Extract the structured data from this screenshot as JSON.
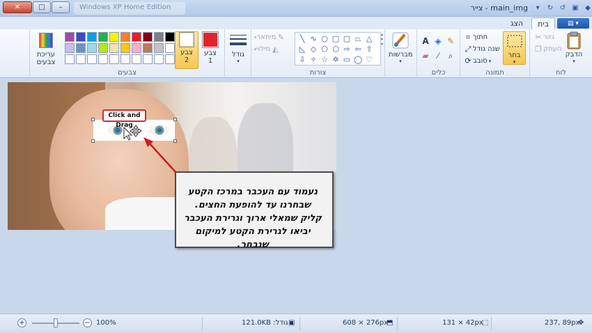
{
  "window": {
    "title": "צייר - main_img",
    "background_tab": "Windows XP Home Edition",
    "controls": {
      "close": "✕",
      "maximize": "□",
      "minimize": "–"
    }
  },
  "ribbon_tabs": {
    "home": "בית",
    "view": "הצג",
    "file_icon": "menu-icon"
  },
  "groups": {
    "clipboard": {
      "label": "לוח",
      "paste": "הדבק",
      "cut": "גזור",
      "copy": "העתק"
    },
    "image": {
      "label": "תמונה",
      "select": "בחר",
      "crop": "חתוך",
      "resize": "שנה גודל",
      "rotate": "סובב"
    },
    "tools": {
      "label": "כלים"
    },
    "brushes": {
      "label": "מברשות"
    },
    "shapes": {
      "label": "צורות",
      "outline": "מיתאר",
      "fill": "מילוי"
    },
    "size": {
      "label": "גודל"
    },
    "colors": {
      "label": "צבעים",
      "color1": "צבע 1",
      "color1_line1": "צבע",
      "color1_line2": "1",
      "color2_line1": "צבע",
      "color2_line2": "2",
      "edit_colors_line1": "עריכת",
      "edit_colors_line2": "צבעים",
      "color1_value": "#e5222b",
      "color2_value": "#ffffff",
      "palette_row1": [
        "#000000",
        "#7f7f7f",
        "#880015",
        "#ed1c24",
        "#ff7f27",
        "#fff200",
        "#22b14c",
        "#00a2e8",
        "#3f48cc",
        "#a349a4"
      ],
      "palette_row2": [
        "#ffffff",
        "#c3c3c3",
        "#b97a57",
        "#ffaec9",
        "#ffc90e",
        "#efe4b0",
        "#b5e61d",
        "#99d9ea",
        "#7092be",
        "#c8bfe7"
      ]
    }
  },
  "canvas": {
    "drag_label": "Click and Drag",
    "callout_text": "נעמוד עם העכבר במרכז הקטע שבחרנו עד להופעת החצים. קליק שמאלי ארוך וגרירת העכבר יביאו לגרירת הקטע למיקום שנבחר."
  },
  "status": {
    "cursor_pos": "237, 89px",
    "selection_size": "131 × 42px",
    "image_size": "608 × 276px",
    "file_size": "גודל: 121.0KB",
    "zoom": "100%",
    "zoom_fraction": 0.5
  }
}
